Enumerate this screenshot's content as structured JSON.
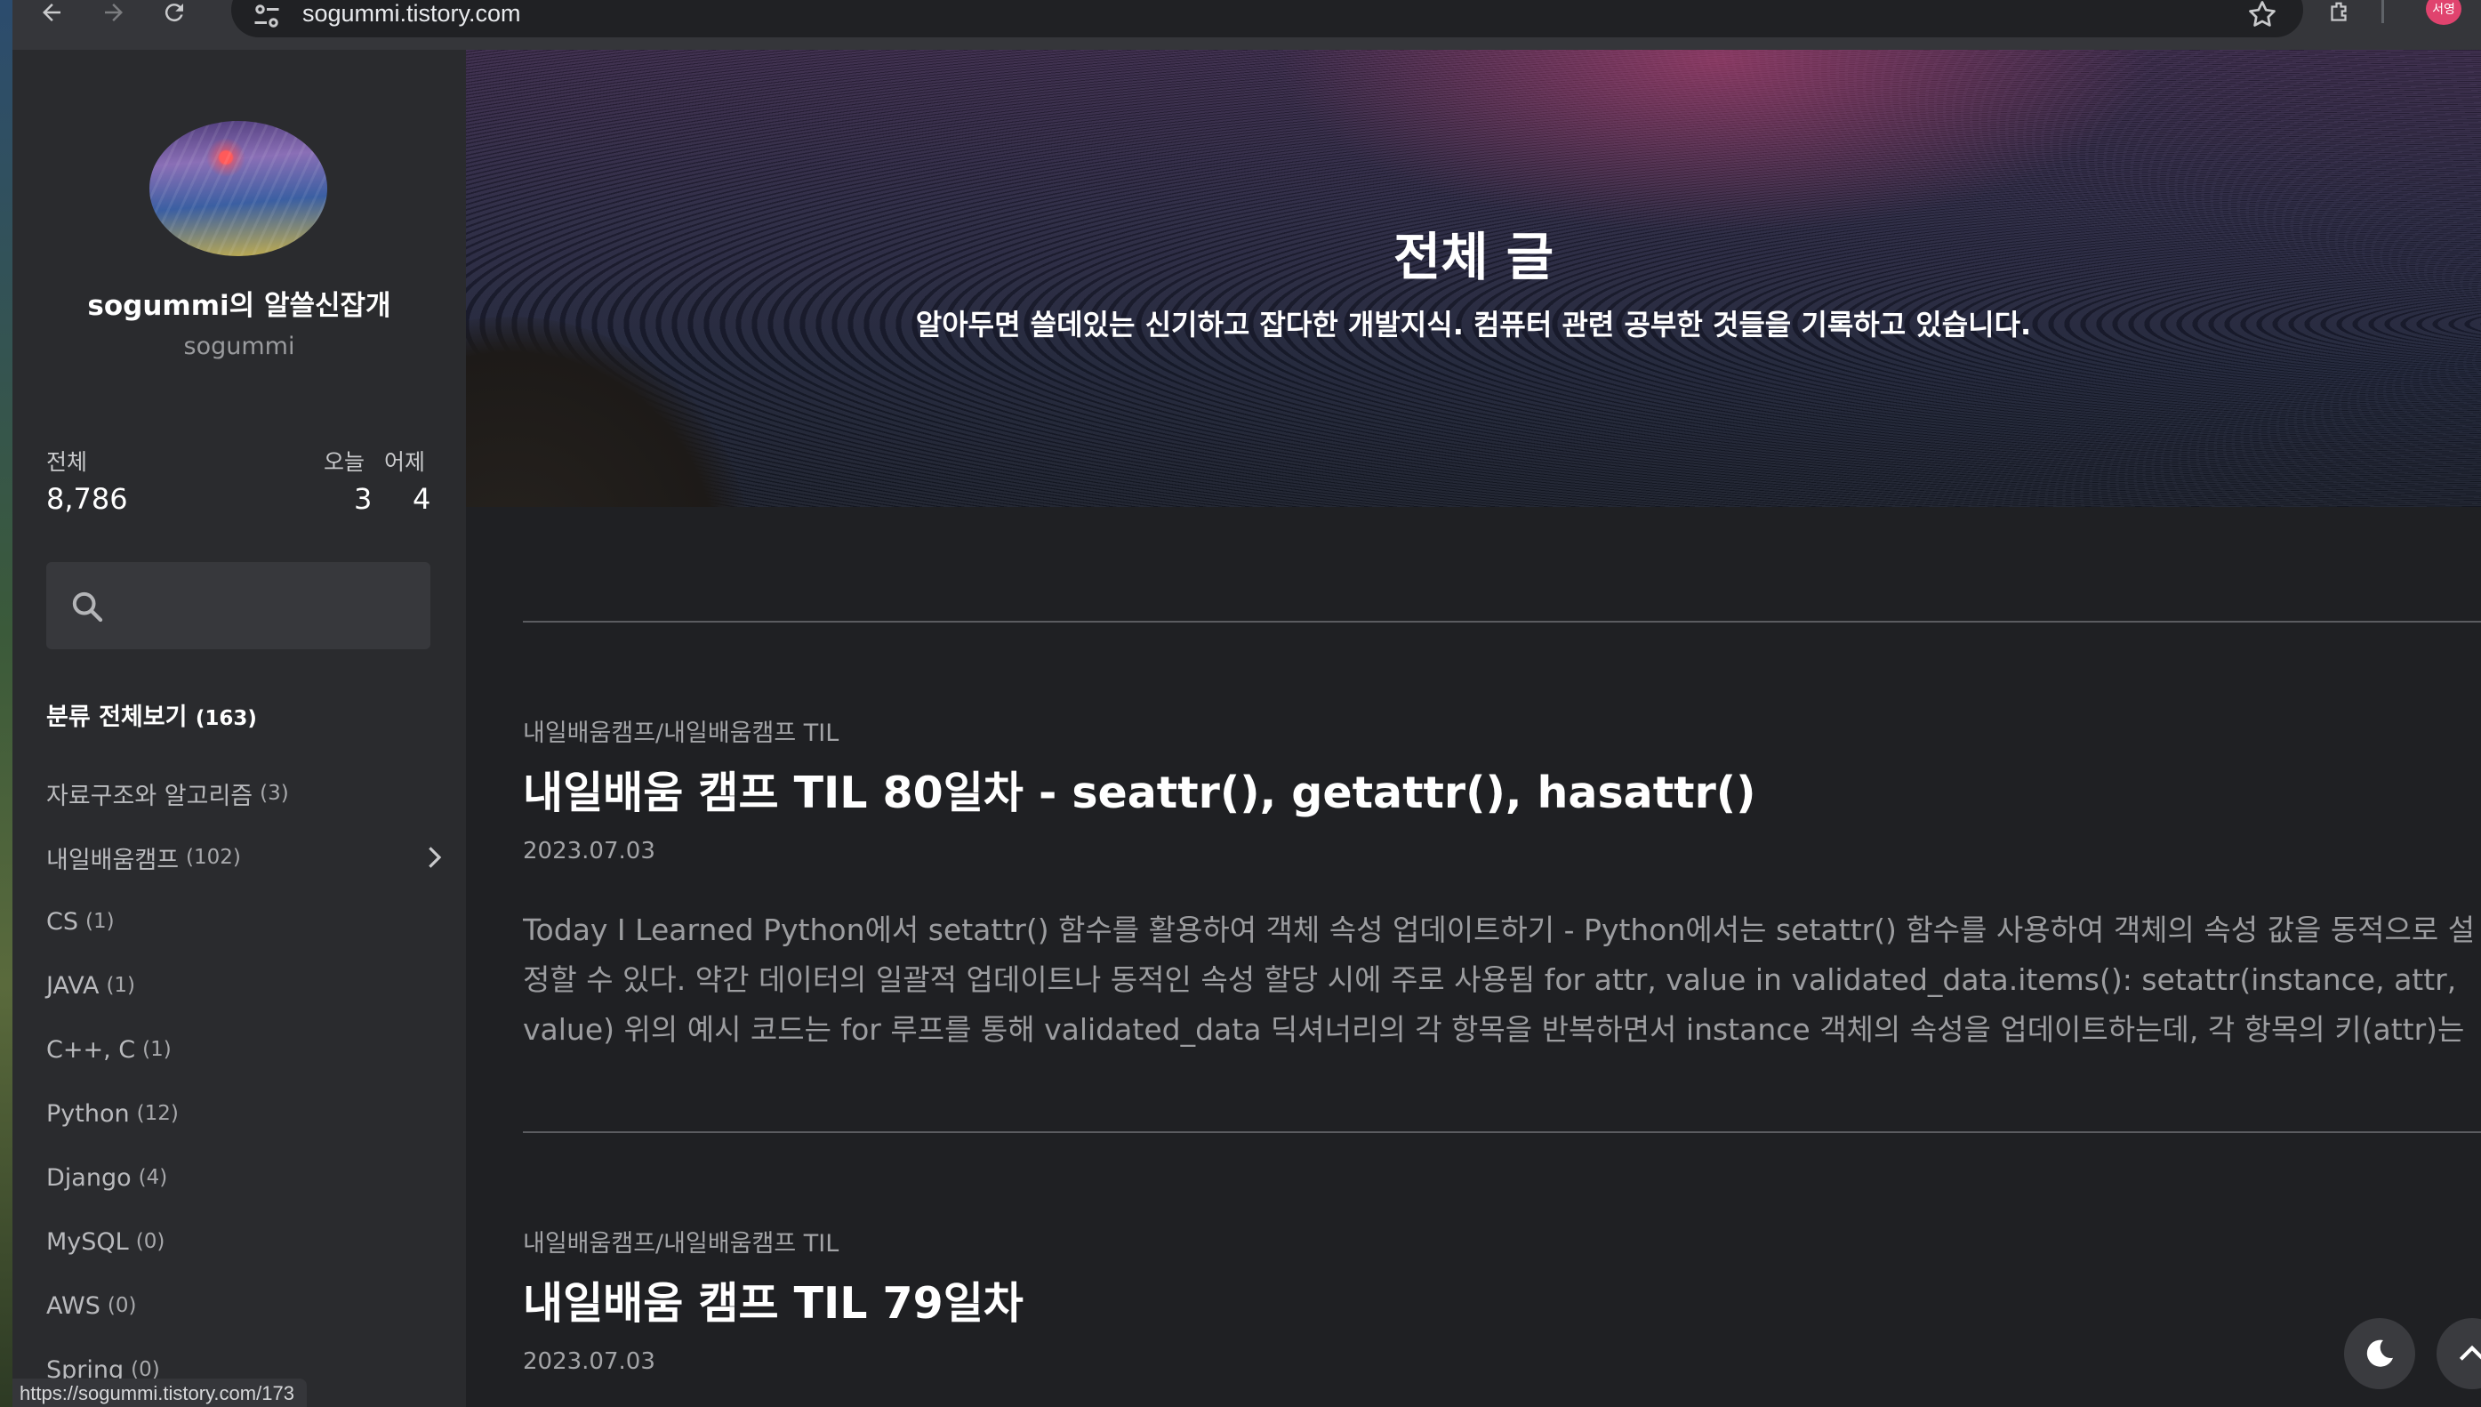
{
  "browser": {
    "url": "sogummi.tistory.com",
    "profile_label": "서영",
    "status_url": "https://sogummi.tistory.com/173"
  },
  "sidebar": {
    "blog_name": "sogummi의 알쓸신잡개",
    "blog_id": "sogummi",
    "stats": {
      "total_label": "전체",
      "total_value": "8,786",
      "today_label": "오늘",
      "today_value": "3",
      "yesterday_label": "어제",
      "yesterday_value": "4"
    },
    "search": {
      "placeholder": ""
    },
    "category_all_label": "분류 전체보기",
    "category_all_count": "(163)",
    "categories": [
      {
        "label": "자료구조와 알고리즘",
        "count": "(3)"
      },
      {
        "label": "내일배움캠프",
        "count": "(102)"
      },
      {
        "label": "CS",
        "count": "(1)"
      },
      {
        "label": "JAVA",
        "count": "(1)"
      },
      {
        "label": "C++, C",
        "count": "(1)"
      },
      {
        "label": "Python",
        "count": "(12)"
      },
      {
        "label": "Django",
        "count": "(4)"
      },
      {
        "label": "MySQL",
        "count": "(0)"
      },
      {
        "label": "AWS",
        "count": "(0)"
      },
      {
        "label": "Spring",
        "count": "(0)"
      }
    ]
  },
  "hero": {
    "title": "전체 글",
    "subtitle": "알아두면 쓸데있는 신기하고 잡다한 개발지식. 컴퓨터 관련 공부한 것들을 기록하고 있습니다."
  },
  "posts": [
    {
      "category": "내일배움캠프/내일배움캠프 TIL",
      "title": "내일배움 캠프 TIL 80일차 - seattr(), getattr(), hasattr()",
      "date": "2023.07.03",
      "excerpt": "Today I Learned Python에서 setattr() 함수를 활용하여 객체 속성 업데이트하기 - Python에서는 setattr() 함수를 사용하여 객체의 속성 값을 동적으로 설정할 수 있다. 약간 데이터의 일괄적 업데이트나 동적인 속성 할당 시에 주로 사용됨 for attr, value in validated_data.items(): setattr(instance, attr, value) 위의 예시 코드는 for 루프를 통해 validated_data 딕셔너리의 각 항목을 반복하면서 instance 객체의 속성을 업데이트하는데, 각 항목의 키(attr)는 instance의 속성 이름이 되고, 값"
    },
    {
      "category": "내일배움캠프/내일배움캠프 TIL",
      "title": "내일배움 캠프 TIL 79일차",
      "date": "2023.07.03"
    }
  ]
}
